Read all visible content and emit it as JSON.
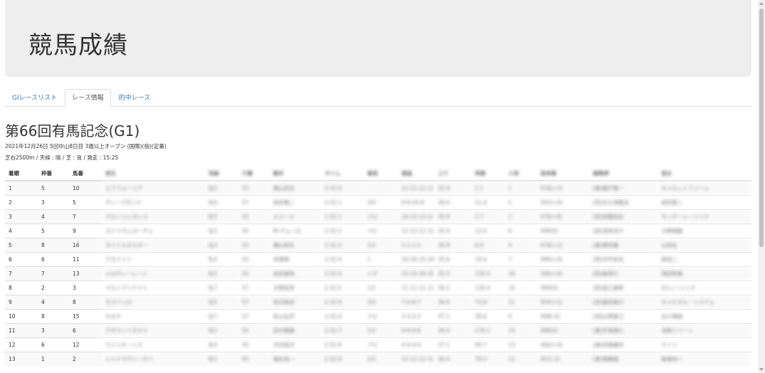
{
  "header": {
    "title": "競馬成績"
  },
  "tabs": [
    {
      "label": "GIレースリスト",
      "active": false
    },
    {
      "label": "レース情報",
      "active": true
    },
    {
      "label": "的中レース",
      "active": false
    }
  ],
  "race": {
    "title": "第66回有馬記念(G1)",
    "info_line1": "2021年12月26日 5回中山8日目 3歳以上オープン (国際)(指)(定量)",
    "info_line2": "芝右2500m / 天候 : 晴 / 芝 : 良 / 発走 : 15:25"
  },
  "table": {
    "headers": [
      "着順",
      "枠番",
      "馬番",
      "馬名",
      "性齢",
      "斤量",
      "騎手",
      "タイム",
      "着差",
      "通過",
      "上り",
      "単勝",
      "人気",
      "馬体重",
      "調教師",
      "馬主"
    ],
    "rows": [
      {
        "rank": "1",
        "waku": "5",
        "umaban": "10",
        "masked": [
          "エフフォーリア",
          "牡3",
          "55",
          "横山武史",
          "2:32.0",
          "",
          "12-12-12-11",
          "35.9",
          "2.1",
          "1",
          "516(+2)",
          "[東]鹿戸雄一",
          "キャロットファーム"
        ]
      },
      {
        "rank": "2",
        "waku": "3",
        "umaban": "5",
        "masked": [
          "ディープボンド",
          "牡4",
          "57",
          "和田竜二",
          "2:32.1",
          "3/4",
          "9-8-10-8",
          "36.0",
          "11.4",
          "5",
          "502(+4)",
          "[西]大久保龍志",
          "前田晋二"
        ]
      },
      {
        "rank": "3",
        "waku": "4",
        "umaban": "7",
        "masked": [
          "クロノジェネシス",
          "牝5",
          "55",
          "ルメール",
          "2:32.1",
          "クビ",
          "14-13-13-11",
          "35.8",
          "2.7",
          "2",
          "470(+8)",
          "[西]斉藤崇史",
          "サンデーレーシング"
        ]
      },
      {
        "rank": "4",
        "waku": "5",
        "umaban": "9",
        "masked": [
          "ステラヴェローチェ",
          "牡3",
          "55",
          "M.デムーロ",
          "2:32.2",
          "クビ",
          "12-12-12-11",
          "35.9",
          "13.0",
          "6",
          "498(0)",
          "[西]須貝尚介",
          "大野剛嗣"
        ]
      },
      {
        "rank": "5",
        "waku": "8",
        "umaban": "16",
        "masked": [
          "タイトルホルダー",
          "牡3",
          "55",
          "横山和生",
          "2:32.3",
          "1/2",
          "1-1-1-1",
          "36.9",
          "6.9",
          "4",
          "476(+2)",
          "[東]栗田徹",
          "山田弘"
        ]
      },
      {
        "rank": "6",
        "waku": "6",
        "umaban": "11",
        "masked": [
          "アカイイト",
          "牝4",
          "55",
          "幸英明",
          "2:32.4",
          "1",
          "16-16-15-14",
          "35.6",
          "19.4",
          "7",
          "480(+4)",
          "[西]中竹和也",
          "岡浩二"
        ]
      },
      {
        "rank": "7",
        "waku": "7",
        "umaban": "13",
        "masked": [
          "メロディーレーン",
          "牝5",
          "55",
          "岩田望来",
          "2:32.4",
          "ハナ",
          "15-15-16-16",
          "35.5",
          "216.5",
          "16",
          "340(+6)",
          "[西]森秀行",
          "岡田牧雄"
        ]
      },
      {
        "rank": "8",
        "waku": "2",
        "umaban": "3",
        "masked": [
          "ペルシアンナイト",
          "牡7",
          "57",
          "大野拓弥",
          "2:32.5",
          "1/2",
          "11-11-11-11",
          "36.2",
          "126.4",
          "14",
          "494(0)",
          "[西]池江泰寿",
          "G1レーシング"
        ]
      },
      {
        "rank": "9",
        "waku": "4",
        "umaban": "8",
        "masked": [
          "モズベッロ",
          "牡5",
          "57",
          "田辺裕信",
          "2:32.6",
          "3/4",
          "7-6-8-7",
          "36.6",
          "73.8",
          "11",
          "504(+2)",
          "[西]森田直行",
          "キャピタル・システム"
        ]
      },
      {
        "rank": "10",
        "waku": "8",
        "umaban": "15",
        "masked": [
          "キセキ",
          "牡7",
          "57",
          "松山弘平",
          "2:32.6",
          "クビ",
          "3-3-3-3",
          "37.1",
          "38.6",
          "9",
          "498(-4)",
          "[西]辻野泰之",
          "石川達絵"
        ]
      },
      {
        "rank": "11",
        "waku": "3",
        "umaban": "6",
        "masked": [
          "アサマノイタズラ",
          "牡3",
          "55",
          "田中勝春",
          "2:32.7",
          "1/2",
          "9-8-8-8",
          "36.9",
          "170.2",
          "15",
          "486(0)",
          "[東]手塚貴久",
          "浅間リゾート"
        ]
      },
      {
        "rank": "12",
        "waku": "6",
        "umaban": "12",
        "masked": [
          "ウインキートス",
          "牝4",
          "55",
          "丹内祐次",
          "2:32.8",
          "クビ",
          "4-4-4-4",
          "37.1",
          "99.7",
          "13",
          "460(+4)",
          "[東]宗像義忠",
          "ウイン"
        ]
      },
      {
        "rank": "13",
        "waku": "1",
        "umaban": "2",
        "masked": [
          "シャドウディーヴァ",
          "牝5",
          "55",
          "福永祐一",
          "2:32.9",
          "1/2",
          "12-12-12-11",
          "36.4",
          "79.3",
          "12",
          "452(-2)",
          "[東]斎藤誠",
          "飯塚知一"
        ]
      }
    ]
  }
}
